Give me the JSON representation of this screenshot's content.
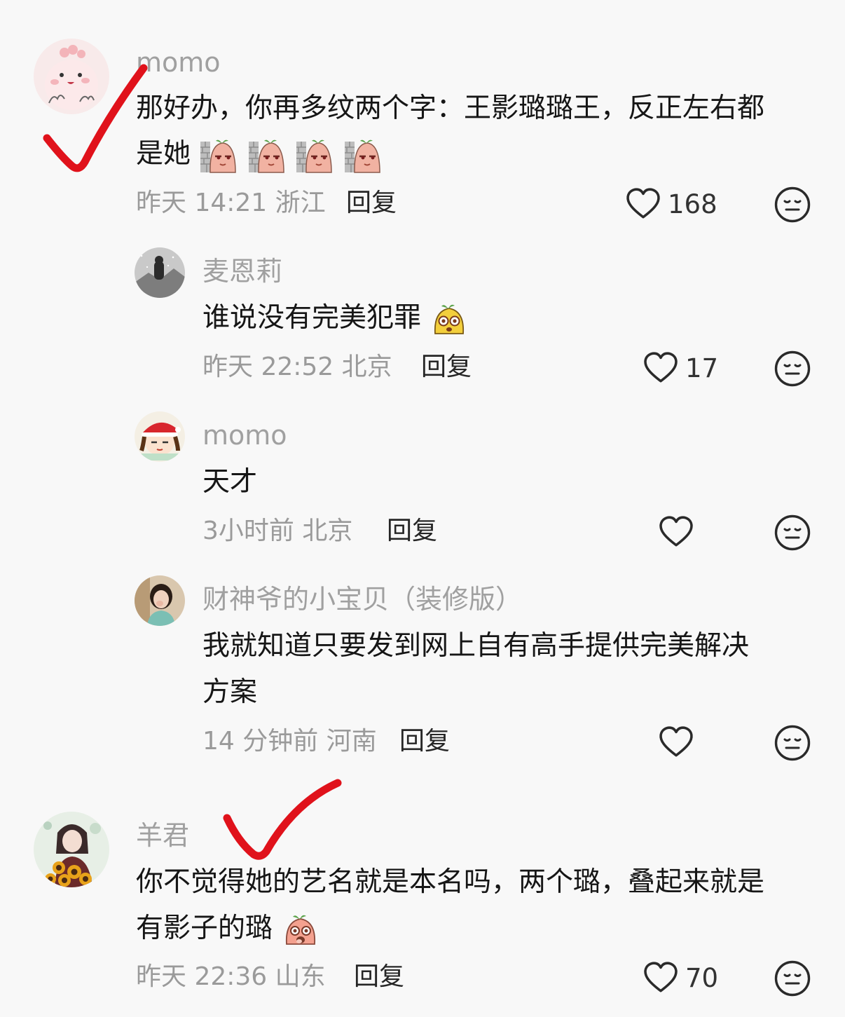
{
  "comments": [
    {
      "user": "momo",
      "text_line1": "那好办，你再多纹两个字：王影璐璐王，反正左右都",
      "text_line2": "是她",
      "time": "昨天 14:21",
      "location": "浙江",
      "reply_label": "回复",
      "likes": "168",
      "emoji_count": 4
    },
    {
      "user": "麦恩莉",
      "text_line1": "谁说没有完美犯罪",
      "time": "昨天 22:52",
      "location": "北京",
      "reply_label": "回复",
      "likes": "17"
    },
    {
      "user": "momo",
      "text_line1": "天才",
      "time": "3小时前",
      "location": "北京",
      "reply_label": "回复",
      "likes": ""
    },
    {
      "user": "财神爷的小宝贝（装修版）",
      "text_line1": "我就知道只要发到网上自有高手提供完美解决",
      "text_line2": "方案",
      "time": "14 分钟前",
      "location": "河南",
      "reply_label": "回复",
      "likes": ""
    },
    {
      "user": "羊君",
      "text_line1": "你不觉得她的艺名就是本名吗，两个璐，叠起来就是",
      "text_line2": "有影子的璐",
      "time": "昨天 22:36",
      "location": "山东",
      "reply_label": "回复",
      "likes": "70"
    }
  ],
  "icons": {
    "like": "heart-outline-icon",
    "dislike": "neutral-face-icon",
    "annotation": "red-checkmark"
  },
  "colors": {
    "background": "#f8f8f8",
    "username": "#a0a0a0",
    "text": "#161616",
    "meta": "#9a9a9a",
    "checkmark": "#e0121b"
  }
}
